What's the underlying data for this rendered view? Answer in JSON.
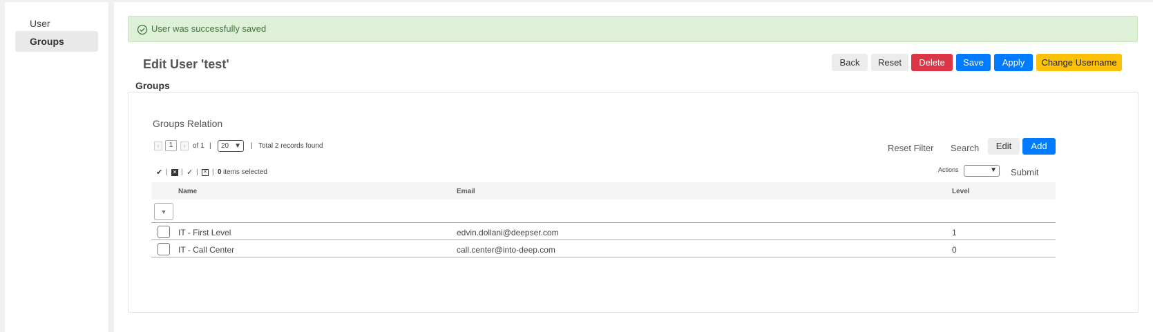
{
  "sidebar": {
    "items": [
      {
        "label": "User"
      },
      {
        "label": "Groups"
      }
    ]
  },
  "alert": {
    "message": "User was successfully saved",
    "icon": "check-circle-icon",
    "color": "#3c763d"
  },
  "header": {
    "title": "Edit User 'test'",
    "buttons": {
      "back": "Back",
      "reset": "Reset",
      "delete": "Delete",
      "save": "Save",
      "apply": "Apply",
      "change_username": "Change Username"
    }
  },
  "section": {
    "title": "Groups"
  },
  "grid": {
    "title": "Groups Relation",
    "pager": {
      "page": "1",
      "of_label": "of 1",
      "per_page": "20",
      "total_label": "Total 2 records found"
    },
    "toolbar": {
      "reset_filter": "Reset Filter",
      "search": "Search",
      "edit": "Edit",
      "add": "Add"
    },
    "massaction": {
      "selected_count": "0",
      "selected_label": "items selected",
      "actions_label": "Actions",
      "submit": "Submit"
    },
    "columns": [
      "Name",
      "Email",
      "Level"
    ],
    "rows": [
      {
        "name": "IT - First Level",
        "email": "edvin.dollani@deepser.com",
        "level": "1"
      },
      {
        "name": "IT - Call Center",
        "email": "call.center@into-deep.com",
        "level": "0"
      }
    ]
  },
  "colors": {
    "primary": "#007bff",
    "danger": "#dc3545",
    "warning": "#ffc107",
    "success_bg": "#dff0d8"
  }
}
